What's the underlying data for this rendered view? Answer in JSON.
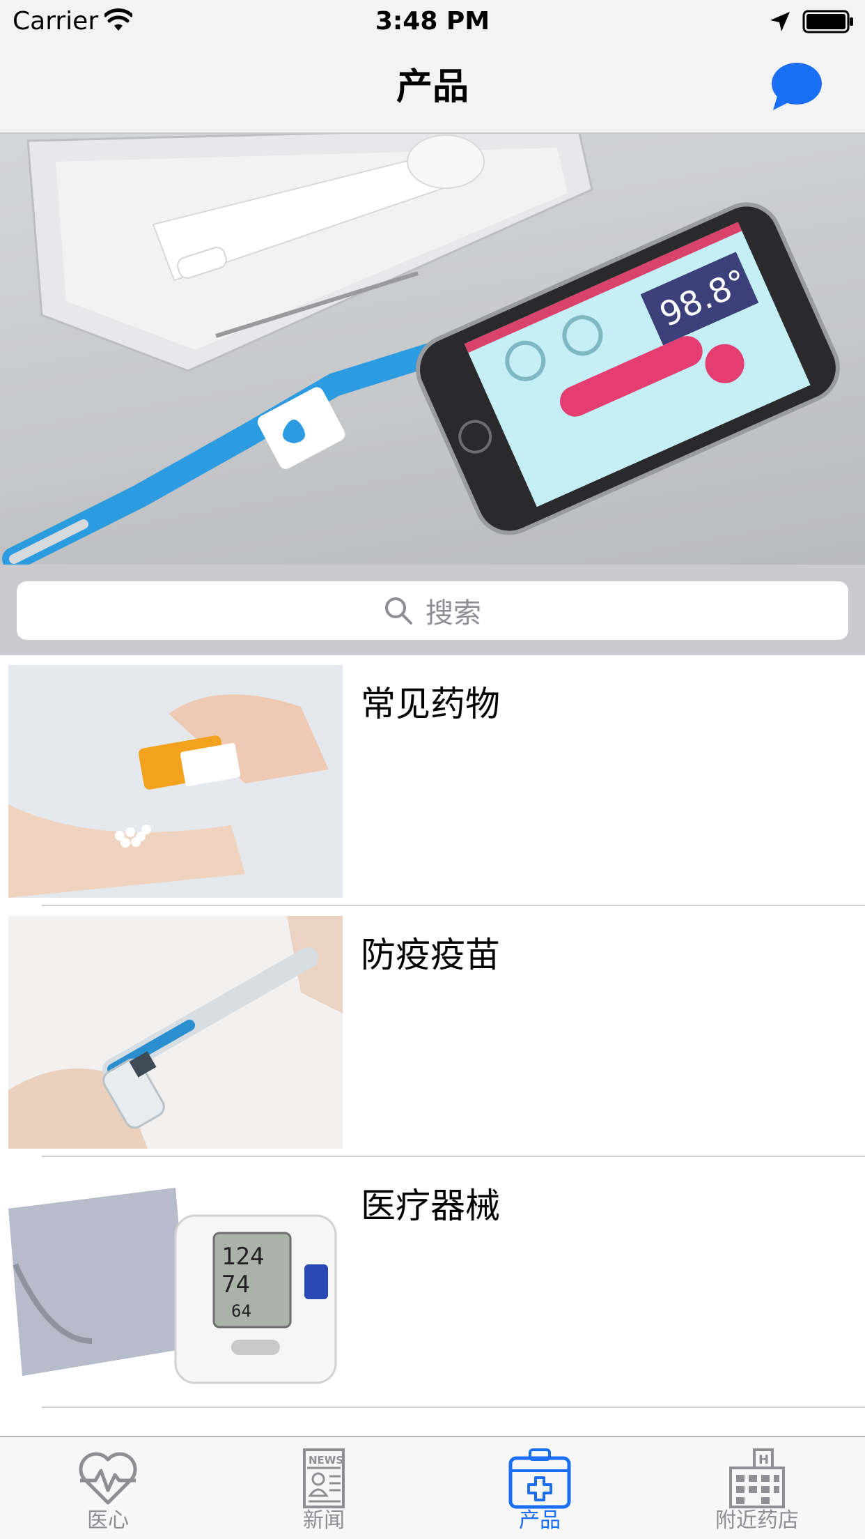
{
  "status_bar": {
    "carrier": "Carrier",
    "time": "3:48 PM"
  },
  "nav": {
    "title": "产品",
    "chat_icon": "chat-bubble-icon"
  },
  "hero": {
    "image": "smart-thermometer-phone-banner",
    "phone_reading": "98.8°"
  },
  "search": {
    "placeholder": "搜索",
    "icon": "search-icon"
  },
  "list": {
    "items": [
      {
        "label": "常见药物",
        "image": "pills-in-hand-photo"
      },
      {
        "label": "防疫疫苗",
        "image": "syringe-vial-photo"
      },
      {
        "label": "医疗器械",
        "image": "blood-pressure-monitor-photo"
      }
    ]
  },
  "tab_bar": {
    "items": [
      {
        "label": "医心",
        "icon": "heart-pulse-icon",
        "active": false
      },
      {
        "label": "新闻",
        "icon": "newspaper-icon",
        "active": false
      },
      {
        "label": "产品",
        "icon": "medical-kit-icon",
        "active": true
      },
      {
        "label": "附近药店",
        "icon": "hospital-building-icon",
        "active": false
      }
    ]
  },
  "colors": {
    "accent": "#1a6ef5",
    "inactive_tab": "#8e8e93",
    "search_bg": "#c9c9ce",
    "bar_bg": "#f3f3f3",
    "thermometer_blue": "#2d9be0"
  }
}
